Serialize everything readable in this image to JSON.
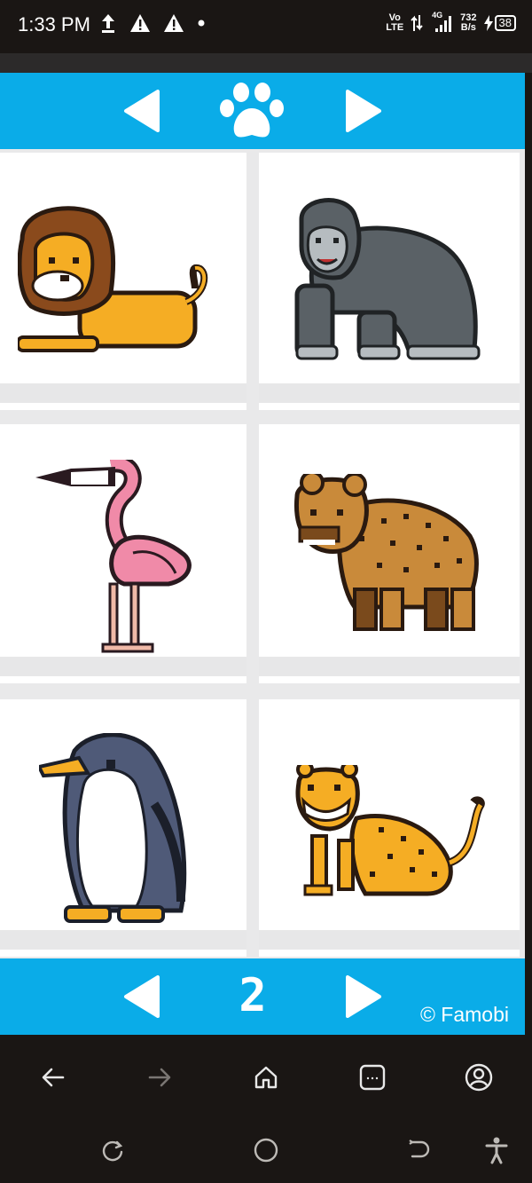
{
  "status_bar": {
    "time": "1:33 PM",
    "volte_line1": "Vo",
    "volte_line2": "LTE",
    "network": "4G",
    "speed_value": "732",
    "speed_unit": "B/s",
    "battery": "38"
  },
  "game": {
    "top_bar": {
      "center_icon": "paw-icon"
    },
    "tiles": [
      {
        "animal": "lion"
      },
      {
        "animal": "gorilla"
      },
      {
        "animal": "flamingo"
      },
      {
        "animal": "hyena"
      },
      {
        "animal": "penguin"
      },
      {
        "animal": "cheetah"
      }
    ],
    "bottom_bar": {
      "page_number": "2",
      "credit": "© Famobi"
    }
  },
  "browser_nav": {
    "icons": [
      "back-arrow-icon",
      "forward-arrow-icon",
      "home-icon",
      "tabs-icon",
      "account-icon"
    ]
  },
  "system_nav": {
    "icons": [
      "recent-apps-icon",
      "home-circle-icon",
      "back-icon",
      "accessibility-icon"
    ]
  },
  "colors": {
    "accent": "#0aace8",
    "background": "#e9e9ea",
    "dark": "#1a1614"
  }
}
